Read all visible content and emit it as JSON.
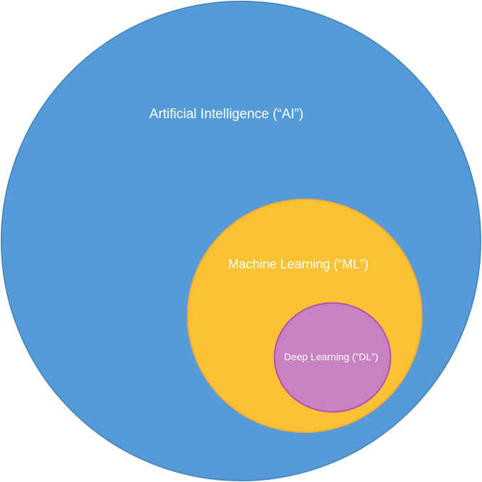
{
  "diagram": {
    "colors": {
      "background": "#ffffff",
      "ai_fill": "#559bd7",
      "ai_stroke": "#4a88c0",
      "ml_fill": "#f8c234",
      "ml_stroke": "#f5a93a",
      "dl_fill": "#c882bf",
      "dl_stroke": "#b44fb0",
      "label_text": "#ffffff"
    },
    "ai": {
      "label": "Artificial Intelligence (“AI”)"
    },
    "ml": {
      "label": "Machine Learning (“ML”)"
    },
    "dl": {
      "label": "Deep Learning (“DL”)"
    }
  }
}
